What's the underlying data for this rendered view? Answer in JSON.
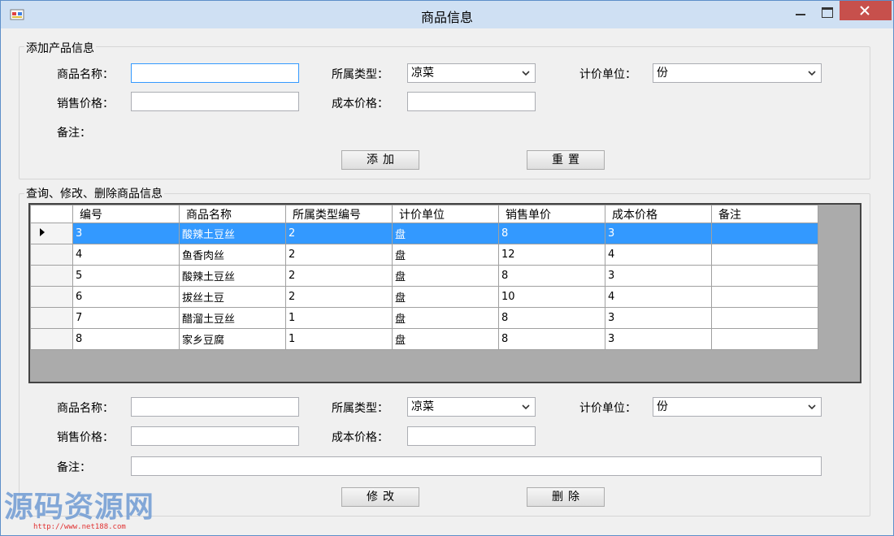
{
  "window": {
    "title": "商品信息"
  },
  "add_group": {
    "legend": "添加产品信息",
    "name_label": "商品名称：",
    "name_value": "",
    "type_label": "所属类型：",
    "type_selected": "凉菜",
    "unit_label": "计价单位：",
    "unit_selected": "份",
    "price_label": "销售价格：",
    "price_value": "",
    "cost_label": "成本价格：",
    "cost_value": "",
    "remark_label": "备注：",
    "add_button": "添加",
    "reset_button": "重置"
  },
  "query_group": {
    "legend": "查询、修改、删除商品信息",
    "columns": [
      "编号",
      "商品名称",
      "所属类型编号",
      "计价单位",
      "销售单价",
      "成本价格",
      "备注"
    ],
    "rows": [
      [
        "3",
        "酸辣土豆丝",
        "2",
        "盘",
        "8",
        "3",
        ""
      ],
      [
        "4",
        "鱼香肉丝",
        "2",
        "盘",
        "12",
        "4",
        ""
      ],
      [
        "5",
        "酸辣土豆丝",
        "2",
        "盘",
        "8",
        "3",
        ""
      ],
      [
        "6",
        "拔丝土豆",
        "2",
        "盘",
        "10",
        "4",
        ""
      ],
      [
        "7",
        "醋溜土豆丝",
        "1",
        "盘",
        "8",
        "3",
        ""
      ],
      [
        "8",
        "家乡豆腐",
        "1",
        "盘",
        "8",
        "3",
        ""
      ]
    ],
    "selected_row": 0,
    "name_label": "商品名称：",
    "name_value": "",
    "type_label": "所属类型：",
    "type_selected": "凉菜",
    "unit_label": "计价单位：",
    "unit_selected": "份",
    "price_label": "销售价格：",
    "price_value": "",
    "cost_label": "成本价格：",
    "cost_value": "",
    "remark_label": "备注：",
    "remark_value": "",
    "modify_button": "修改",
    "delete_button": "删除"
  },
  "watermark": {
    "text": "源码资源网",
    "url": "http://www.net188.com"
  },
  "colors": {
    "selection": "#3399ff",
    "close_button": "#c7504c",
    "titlebar": "#cfe0f3"
  }
}
